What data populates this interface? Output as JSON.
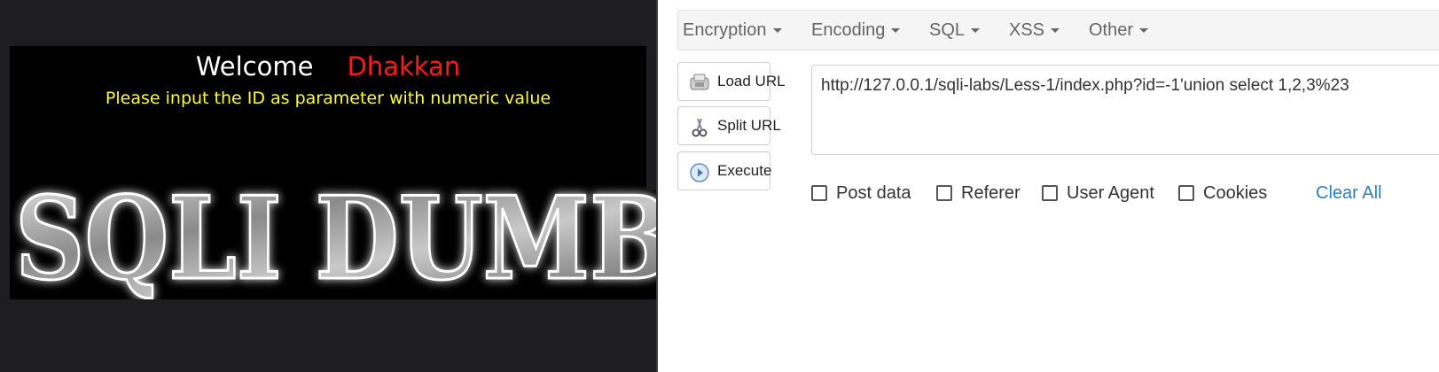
{
  "page": {
    "welcome_word": "Welcome",
    "welcome_name": "Dhakkan",
    "instruction": "Please input the ID as parameter with numeric value",
    "logo_text": "SQLI DUMB"
  },
  "hackbar": {
    "menu": [
      {
        "label": "Encryption"
      },
      {
        "label": "Encoding"
      },
      {
        "label": "SQL"
      },
      {
        "label": "XSS"
      },
      {
        "label": "Other"
      }
    ],
    "buttons": {
      "load_url": "Load URL",
      "split_url": "Split URL",
      "execute": "Execute"
    },
    "url_value": "http://127.0.0.1/sqli-labs/Less-1/index.php?id=-1'union select 1,2,3%23",
    "options": {
      "post_data": "Post data",
      "referer": "Referer",
      "user_agent": "User Agent",
      "cookies": "Cookies"
    },
    "clear_all": "Clear All"
  },
  "colors": {
    "welcome_name": "#ff1a1a",
    "instruction": "#ffff33",
    "link": "#2f7dbd"
  }
}
